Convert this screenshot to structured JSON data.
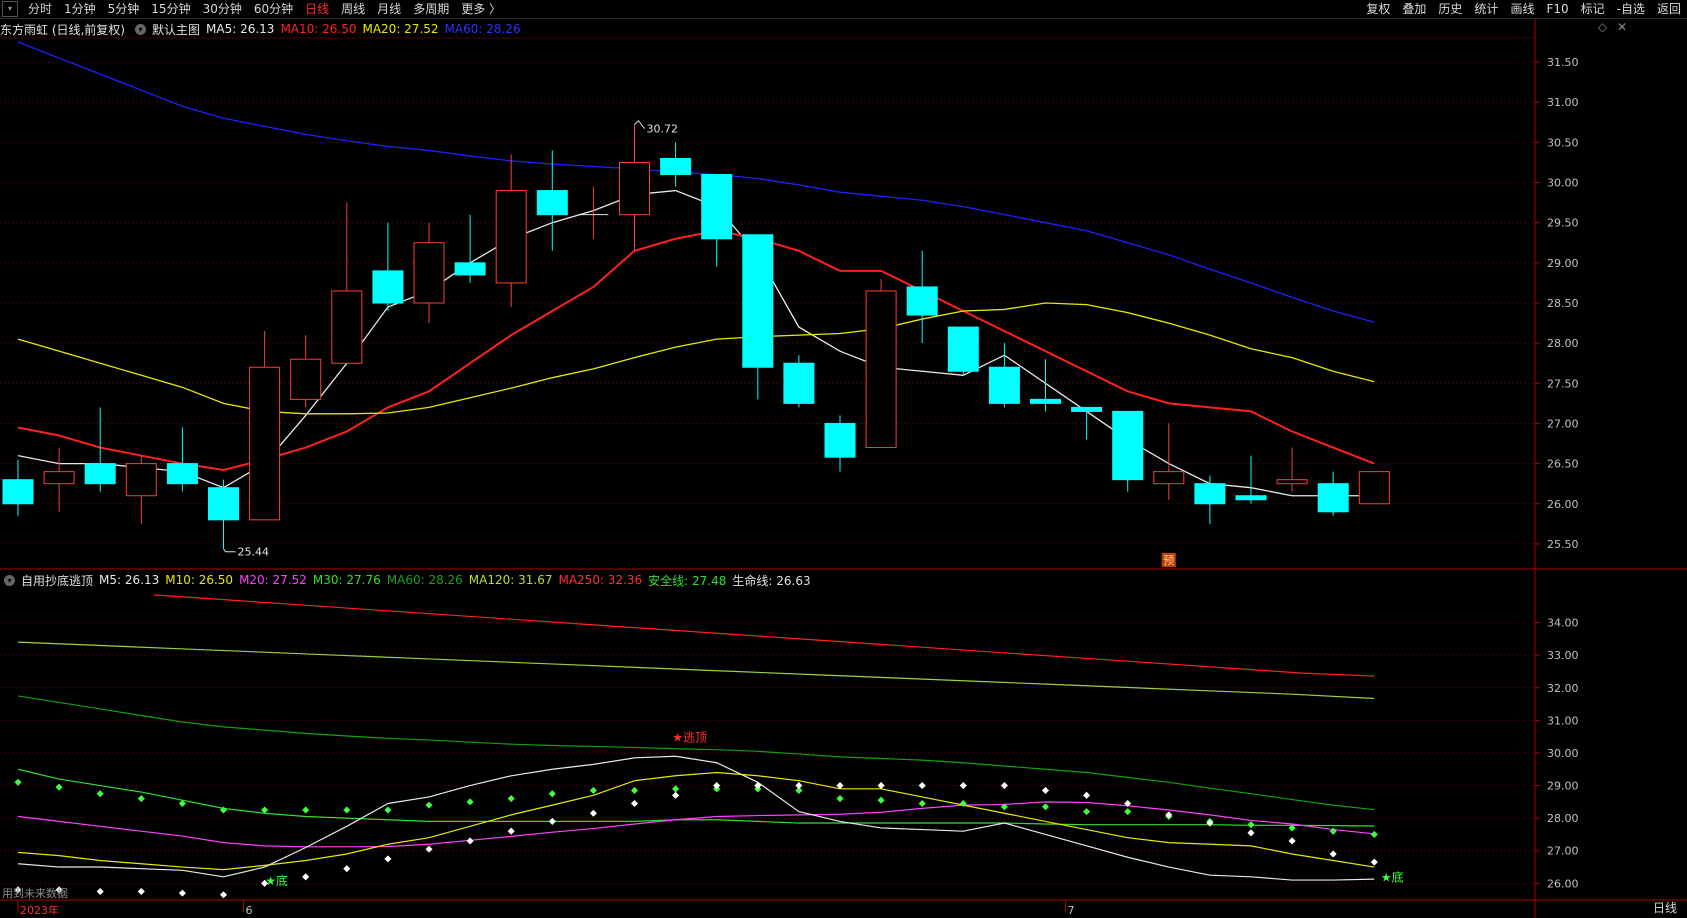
{
  "toolbar": {
    "left": [
      "分时",
      "1分钟",
      "5分钟",
      "15分钟",
      "30分钟",
      "60分钟",
      "日线",
      "周线",
      "月线",
      "多周期",
      "更多 〉"
    ],
    "active_index": 6,
    "right": [
      "复权",
      "叠加",
      "历史",
      "统计",
      "画线",
      "F10",
      "标记",
      "-自选",
      "返回"
    ]
  },
  "main_header": {
    "title": "东方雨虹 (日线,前复权)",
    "main_label": "默认主图",
    "ma5": "MA5: 26.13",
    "ma10": "MA10: 26.50",
    "ma20": "MA20: 27.52",
    "ma60": "MA60: 28.26"
  },
  "sub_header": {
    "title": "自用抄底逃顶",
    "m5": "M5: 26.13",
    "m10": "M10: 26.50",
    "m20": "M20: 27.52",
    "m30": "M30: 27.76",
    "ma60": "MA60: 28.26",
    "ma120": "MA120: 31.67",
    "ma250": "MA250: 32.36",
    "safe": "安全线: 27.48",
    "life": "生命线: 26.63"
  },
  "colors": {
    "up": "#ff3b3b",
    "down": "#00ffff",
    "ma5": "#e8e8e8",
    "ma10": "#ff2020",
    "ma20": "#e8e800",
    "ma60": "#2020ff",
    "m20": "#ff40ff",
    "ma120": "#ff3030",
    "ma250": "#b0e040",
    "safe": "#20d020",
    "life": "#00ff40",
    "grid": "#800000",
    "axis_text": "#c0c0c0"
  },
  "chart_data": [
    {
      "type": "candlestick",
      "name": "main",
      "ylim": [
        25.2,
        31.8
      ],
      "yticks": [
        "25.50",
        "26.00",
        "26.50",
        "27.00",
        "27.50",
        "28.00",
        "28.50",
        "29.00",
        "29.50",
        "30.00",
        "30.50",
        "31.00",
        "31.50"
      ],
      "xlabels": [
        {
          "i": 0,
          "text": "2023年"
        },
        {
          "i": 5,
          "text": "6"
        },
        {
          "i": 25,
          "text": "7"
        }
      ],
      "annotations": {
        "high": "30.72",
        "low": "25.44",
        "marker": "预"
      },
      "candles": [
        {
          "o": 26.3,
          "c": 26.0,
          "h": 26.55,
          "l": 25.85
        },
        {
          "o": 26.25,
          "c": 26.4,
          "h": 26.7,
          "l": 25.9
        },
        {
          "o": 26.5,
          "c": 26.25,
          "h": 27.2,
          "l": 26.15
        },
        {
          "o": 26.1,
          "c": 26.5,
          "h": 26.6,
          "l": 25.75
        },
        {
          "o": 26.5,
          "c": 26.25,
          "h": 26.95,
          "l": 26.15
        },
        {
          "o": 26.2,
          "c": 25.8,
          "h": 26.3,
          "l": 25.44
        },
        {
          "o": 25.8,
          "c": 27.7,
          "h": 28.15,
          "l": 25.8
        },
        {
          "o": 27.3,
          "c": 27.8,
          "h": 28.1,
          "l": 27.2
        },
        {
          "o": 27.75,
          "c": 28.65,
          "h": 29.75,
          "l": 27.75
        },
        {
          "o": 28.9,
          "c": 28.5,
          "h": 29.5,
          "l": 28.4
        },
        {
          "o": 28.5,
          "c": 29.25,
          "h": 29.5,
          "l": 28.25
        },
        {
          "o": 29.0,
          "c": 28.85,
          "h": 29.6,
          "l": 28.75
        },
        {
          "o": 28.75,
          "c": 29.9,
          "h": 30.35,
          "l": 28.45
        },
        {
          "o": 29.9,
          "c": 29.6,
          "h": 30.4,
          "l": 29.15
        },
        {
          "o": 29.6,
          "c": 29.6,
          "h": 29.95,
          "l": 29.3
        },
        {
          "o": 29.6,
          "c": 30.25,
          "h": 30.72,
          "l": 29.15
        },
        {
          "o": 30.3,
          "c": 30.1,
          "h": 30.5,
          "l": 29.95
        },
        {
          "o": 30.1,
          "c": 29.3,
          "h": 30.1,
          "l": 28.95
        },
        {
          "o": 29.35,
          "c": 27.7,
          "h": 29.35,
          "l": 27.3
        },
        {
          "o": 27.75,
          "c": 27.25,
          "h": 27.85,
          "l": 27.2
        },
        {
          "o": 27.0,
          "c": 26.58,
          "h": 27.1,
          "l": 26.4
        },
        {
          "o": 26.7,
          "c": 28.65,
          "h": 28.8,
          "l": 26.7
        },
        {
          "o": 28.7,
          "c": 28.35,
          "h": 29.15,
          "l": 28.0
        },
        {
          "o": 28.2,
          "c": 27.65,
          "h": 28.2,
          "l": 27.6
        },
        {
          "o": 27.7,
          "c": 27.25,
          "h": 28.0,
          "l": 27.2
        },
        {
          "o": 27.3,
          "c": 27.25,
          "h": 27.8,
          "l": 27.15
        },
        {
          "o": 27.2,
          "c": 27.15,
          "h": 27.2,
          "l": 26.8
        },
        {
          "o": 27.15,
          "c": 26.3,
          "h": 27.15,
          "l": 26.15
        },
        {
          "o": 26.25,
          "c": 26.4,
          "h": 27.0,
          "l": 26.05
        },
        {
          "o": 26.25,
          "c": 26.0,
          "h": 26.35,
          "l": 25.75
        },
        {
          "o": 26.1,
          "c": 26.05,
          "h": 26.6,
          "l": 26.0
        },
        {
          "o": 26.25,
          "c": 26.3,
          "h": 26.7,
          "l": 26.15
        },
        {
          "o": 26.25,
          "c": 25.9,
          "h": 26.4,
          "l": 25.85
        },
        {
          "o": 26.0,
          "c": 26.4,
          "h": 26.4,
          "l": 26.0
        }
      ],
      "series": [
        {
          "name": "MA5",
          "color_key": "ma5",
          "values": [
            26.6,
            26.5,
            26.5,
            26.45,
            26.4,
            26.2,
            26.5,
            27.1,
            27.75,
            28.45,
            28.65,
            29.0,
            29.3,
            29.5,
            29.65,
            29.85,
            29.9,
            29.7,
            29.1,
            28.2,
            27.9,
            27.7,
            27.65,
            27.6,
            27.85,
            27.5,
            27.15,
            26.8,
            26.5,
            26.25,
            26.2,
            26.1,
            26.1,
            26.1
          ]
        },
        {
          "name": "MA10",
          "color_key": "ma10",
          "values": [
            26.95,
            26.85,
            26.7,
            26.6,
            26.5,
            26.42,
            26.55,
            26.7,
            26.9,
            27.2,
            27.4,
            27.75,
            28.1,
            28.4,
            28.7,
            29.15,
            29.3,
            29.4,
            29.3,
            29.15,
            28.9,
            28.9,
            28.65,
            28.4,
            28.15,
            27.9,
            27.65,
            27.4,
            27.25,
            27.2,
            27.15,
            26.9,
            26.7,
            26.5
          ]
        },
        {
          "name": "MA20",
          "color_key": "ma20",
          "values": [
            28.05,
            27.9,
            27.75,
            27.6,
            27.45,
            27.25,
            27.15,
            27.12,
            27.12,
            27.13,
            27.2,
            27.32,
            27.44,
            27.57,
            27.68,
            27.82,
            27.95,
            28.05,
            28.08,
            28.1,
            28.12,
            28.18,
            28.3,
            28.4,
            28.42,
            28.5,
            28.48,
            28.38,
            28.25,
            28.1,
            27.93,
            27.82,
            27.65,
            27.52
          ]
        },
        {
          "name": "MA60",
          "color_key": "ma60",
          "values": [
            31.75,
            31.55,
            31.35,
            31.15,
            30.95,
            30.8,
            30.7,
            30.6,
            30.52,
            30.45,
            30.4,
            30.33,
            30.27,
            30.23,
            30.2,
            30.17,
            30.13,
            30.1,
            30.05,
            29.97,
            29.88,
            29.83,
            29.78,
            29.7,
            29.6,
            29.5,
            29.4,
            29.25,
            29.1,
            28.92,
            28.75,
            28.57,
            28.4,
            28.26
          ]
        }
      ]
    },
    {
      "type": "line",
      "name": "indicator",
      "ylim": [
        25.55,
        35.0
      ],
      "yticks": [
        "26.00",
        "27.00",
        "28.00",
        "29.00",
        "30.00",
        "31.00",
        "32.00",
        "33.00",
        "34.00"
      ],
      "annotations": {
        "top_signal": "★逃顶",
        "bottom_signal": "★底",
        "note": "用到未来数据"
      },
      "series": [
        {
          "name": "MA250",
          "color_key": "ma120",
          "x_start": 3.3,
          "values": [
            34.85,
            34.7,
            34.55,
            34.4,
            34.25,
            34.1,
            33.95,
            33.8,
            33.65,
            33.5,
            33.35,
            33.2,
            33.05,
            32.9,
            32.75,
            32.6,
            32.45,
            32.36
          ]
        },
        {
          "name": "MA120",
          "color_key": "ma250",
          "x_start": 0,
          "values": [
            33.4,
            33.3,
            33.2,
            33.1,
            33.0,
            32.9,
            32.8,
            32.7,
            32.6,
            32.5,
            32.4,
            32.3,
            32.2,
            32.1,
            32.0,
            31.9,
            31.8,
            31.67
          ]
        },
        {
          "name": "MA60",
          "color_key": "safe",
          "x_start": 0,
          "values": [
            31.75,
            31.55,
            31.35,
            31.15,
            30.95,
            30.8,
            30.7,
            30.6,
            30.52,
            30.45,
            30.4,
            30.33,
            30.27,
            30.23,
            30.2,
            30.17,
            30.13,
            30.1,
            30.05,
            29.97,
            29.88,
            29.83,
            29.78,
            29.7,
            29.6,
            29.5,
            29.4,
            29.25,
            29.1,
            28.92,
            28.75,
            28.57,
            28.4,
            28.26
          ]
        },
        {
          "name": "M30",
          "color_key": "safe",
          "x_start": 0,
          "values": [
            29.5,
            29.2,
            29.0,
            28.8,
            28.55,
            28.3,
            28.15,
            28.05,
            28.0,
            27.95,
            27.9,
            27.9,
            27.9,
            27.9,
            27.9,
            27.9,
            27.95,
            27.95,
            27.9,
            27.85,
            27.85,
            27.85,
            27.85,
            27.85,
            27.85,
            27.82,
            27.8,
            27.8,
            27.8,
            27.8,
            27.78,
            27.78,
            27.77,
            27.76
          ]
        },
        {
          "name": "M20",
          "color_key": "m20",
          "x_start": 0,
          "values": [
            28.05,
            27.9,
            27.75,
            27.6,
            27.45,
            27.25,
            27.15,
            27.12,
            27.12,
            27.13,
            27.2,
            27.32,
            27.44,
            27.57,
            27.68,
            27.82,
            27.95,
            28.05,
            28.08,
            28.1,
            28.12,
            28.18,
            28.3,
            28.4,
            28.42,
            28.5,
            28.48,
            28.38,
            28.25,
            28.1,
            27.93,
            27.82,
            27.65,
            27.52
          ]
        },
        {
          "name": "M10",
          "color_key": "ma20",
          "x_start": 0,
          "values": [
            26.95,
            26.85,
            26.7,
            26.6,
            26.5,
            26.42,
            26.55,
            26.7,
            26.9,
            27.2,
            27.4,
            27.75,
            28.1,
            28.4,
            28.7,
            29.15,
            29.3,
            29.4,
            29.3,
            29.15,
            28.9,
            28.9,
            28.65,
            28.4,
            28.15,
            27.9,
            27.65,
            27.4,
            27.25,
            27.2,
            27.15,
            26.9,
            26.7,
            26.5
          ]
        },
        {
          "name": "M5",
          "color_key": "ma5",
          "x_start": 0,
          "values": [
            26.6,
            26.5,
            26.5,
            26.45,
            26.4,
            26.2,
            26.5,
            27.1,
            27.75,
            28.45,
            28.65,
            29.0,
            29.3,
            29.5,
            29.65,
            29.85,
            29.9,
            29.7,
            29.1,
            28.2,
            27.9,
            27.7,
            27.65,
            27.6,
            27.85,
            27.5,
            27.15,
            26.8,
            26.5,
            26.25,
            26.2,
            26.1,
            26.1,
            26.13
          ]
        }
      ],
      "dots_green": [
        29.1,
        28.95,
        28.75,
        28.6,
        28.45,
        28.25,
        28.25,
        28.25,
        28.25,
        28.25,
        28.4,
        28.5,
        28.6,
        28.75,
        28.85,
        28.85,
        28.9,
        28.9,
        28.9,
        28.85,
        28.6,
        28.55,
        28.45,
        28.45,
        28.35,
        28.35,
        28.2,
        28.2,
        28.05,
        27.9,
        27.8,
        27.7,
        27.6,
        27.5
      ],
      "dots_white": [
        25.8,
        25.8,
        25.75,
        25.75,
        25.7,
        25.65,
        26.0,
        26.2,
        26.45,
        26.75,
        27.05,
        27.3,
        27.6,
        27.9,
        28.15,
        28.45,
        28.7,
        29.0,
        29.0,
        29.0,
        29.0,
        29.0,
        29.0,
        29.0,
        29.0,
        28.85,
        28.7,
        28.45,
        28.1,
        27.85,
        27.55,
        27.3,
        26.9,
        26.65
      ]
    }
  ]
}
